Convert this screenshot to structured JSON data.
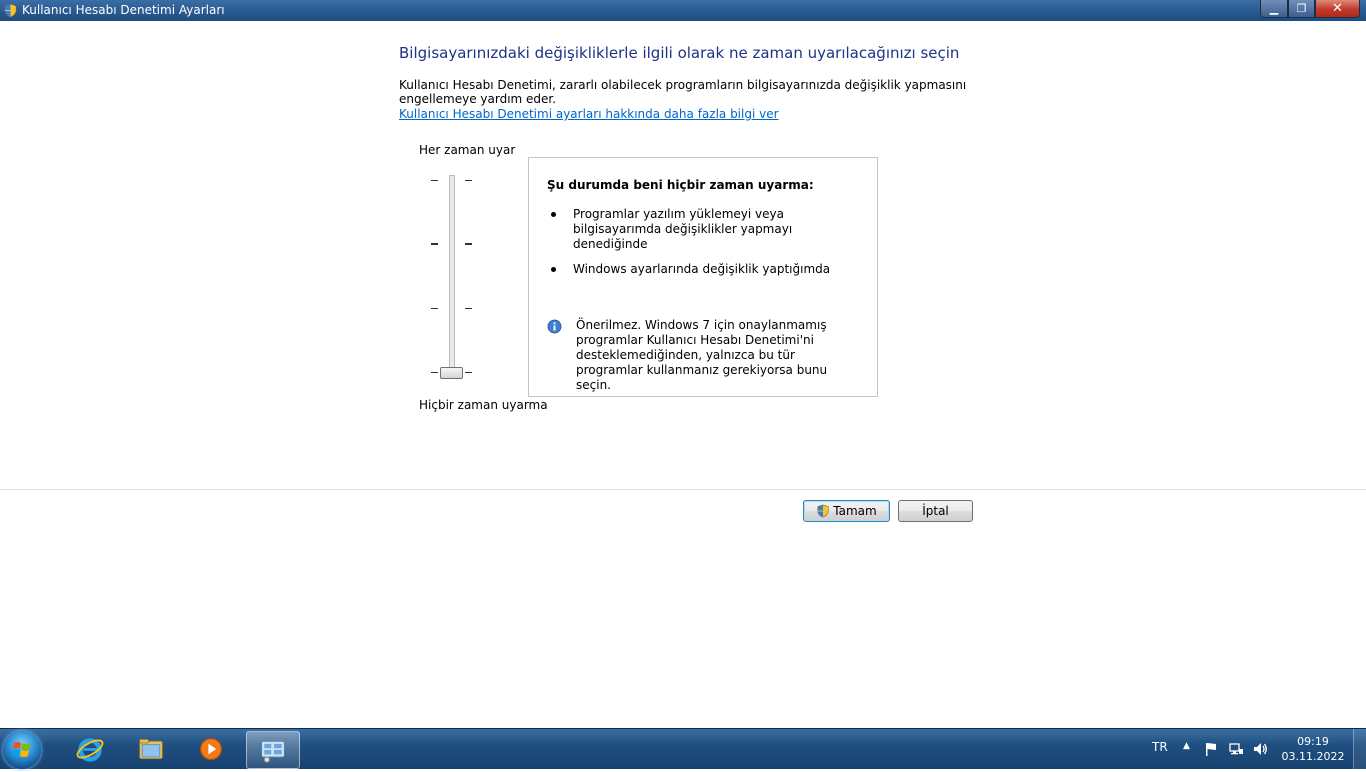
{
  "window": {
    "title": "Kullanıcı Hesabı Denetimi Ayarları",
    "minimize_symbol": "▁",
    "maximize_symbol": "❐",
    "close_symbol": "✕"
  },
  "main": {
    "heading": "Bilgisayarınızdaki değişikliklerle ilgili olarak ne zaman uyarılacağınızı seçin",
    "description": "Kullanıcı Hesabı Denetimi, zararlı olabilecek programların bilgisayarınızda değişiklik yapmasını engellemeye yardım eder.",
    "more_info_link": "Kullanıcı Hesabı Denetimi ayarları hakkında daha fazla bilgi ver"
  },
  "slider": {
    "top_label": "Her zaman uyar",
    "bottom_label": "Hiçbir zaman uyarma",
    "levels": 4,
    "selected_level": 1
  },
  "info_box": {
    "title": "Şu durumda beni hiçbir zaman uyarma:",
    "bullets": [
      "Programlar yazılım yüklemeyi veya bilgisayarımda değişiklikler yapmayı denediğinde",
      "Windows ayarlarında değişiklik yaptığımda"
    ],
    "note": "Önerilmez. Windows 7 için onaylanmamış programlar Kullanıcı Hesabı Denetimi'ni desteklemediğinden, yalnızca bu tür programlar kullanmanız gerekiyorsa bunu seçin."
  },
  "buttons": {
    "ok_label": "Tamam",
    "cancel_label": "İptal"
  },
  "taskbar": {
    "pinned": [
      "start-orb",
      "internet-explorer-icon",
      "windows-explorer-icon",
      "media-player-icon",
      "uac-settings-icon"
    ],
    "tray_language": "TR",
    "tray_arrow": "▲",
    "clock_time": "09:19",
    "clock_date": "03.11.2022"
  },
  "colors": {
    "heading": "#1e3287",
    "link": "#0066cc",
    "taskbar": "#1f4f80"
  }
}
